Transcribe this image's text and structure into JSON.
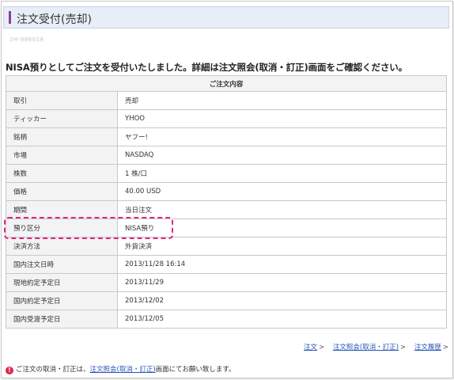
{
  "header": {
    "title": "注文受付(売却)",
    "order_number": "2H-998018"
  },
  "message": "NISA預りとしてご注文を受付いたしました。詳細は注文照会(取消・訂正)画面をご確認ください。",
  "details": {
    "caption": "ご注文内容",
    "rows": [
      {
        "label": "取引",
        "value": "売却"
      },
      {
        "label": "ティッカー",
        "value": "YHOO"
      },
      {
        "label": "銘柄",
        "value": "ヤフー!"
      },
      {
        "label": "市場",
        "value": "NASDAQ"
      },
      {
        "label": "株数",
        "value": "1 株/口"
      },
      {
        "label": "価格",
        "value": "40.00 USD"
      },
      {
        "label": "期間",
        "value": "当日注文"
      },
      {
        "label": "預り区分",
        "value": "NISA預り"
      },
      {
        "label": "決済方法",
        "value": "外貨決済"
      },
      {
        "label": "国内注文日時",
        "value": "2013/11/28 16:14"
      },
      {
        "label": "現地約定予定日",
        "value": "2013/11/29"
      },
      {
        "label": "国内約定予定日",
        "value": "2013/12/02"
      },
      {
        "label": "国内受渡予定日",
        "value": "2013/12/05"
      }
    ],
    "highlighted_row": "預り区分",
    "highlight_color": "#e0267f"
  },
  "links": {
    "order": "注文",
    "order_inquiry": "注文照会(取消・訂正)",
    "order_history": "注文履歴",
    "separator": ">"
  },
  "note": {
    "icon": "exclamation-circle-icon",
    "prefix": "ご注文の取消・訂正は、",
    "link": "注文照会(取消・訂正)",
    "suffix": "画面にてお願い致します。"
  },
  "colors": {
    "accent": "#8a3fa0",
    "title_bg": "#e8eef8",
    "link": "#2a56b8",
    "note_icon": "#e0264a"
  }
}
